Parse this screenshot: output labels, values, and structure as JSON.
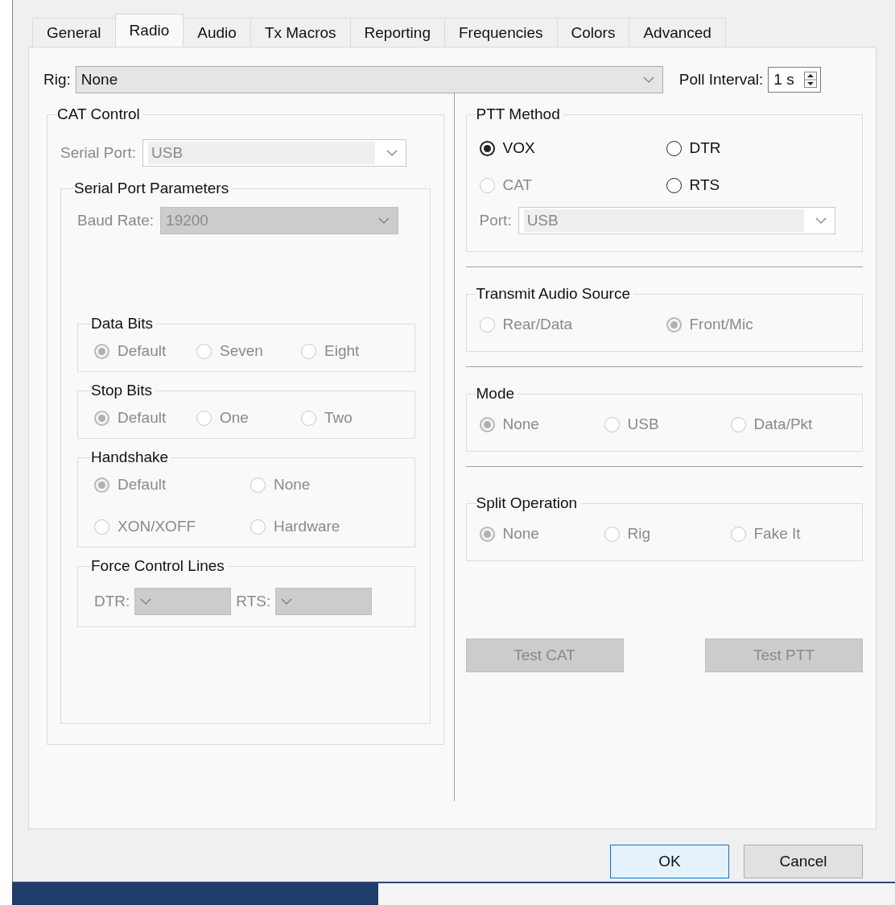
{
  "tabs": [
    {
      "label": "General",
      "selected": false
    },
    {
      "label": "Radio",
      "selected": true
    },
    {
      "label": "Audio",
      "selected": false
    },
    {
      "label": "Tx Macros",
      "selected": false
    },
    {
      "label": "Reporting",
      "selected": false
    },
    {
      "label": "Frequencies",
      "selected": false
    },
    {
      "label": "Colors",
      "selected": false
    },
    {
      "label": "Advanced",
      "selected": false
    }
  ],
  "rig": {
    "label": "Rig:",
    "value": "None",
    "kind": "list",
    "disabled": false
  },
  "poll_interval": {
    "label": "Poll Interval:",
    "value": "1 s"
  },
  "cat_control": {
    "title": "CAT Control",
    "serial_port": {
      "label": "Serial Port:",
      "value": "USB",
      "kind": "combo",
      "disabled": true
    },
    "serial_port_parameters": {
      "title": "Serial Port Parameters",
      "baud_rate": {
        "label": "Baud Rate:",
        "value": "19200",
        "kind": "list",
        "disabled": true
      },
      "data_bits": {
        "title": "Data Bits",
        "options": [
          {
            "label": "Default",
            "selected": true,
            "disabled": true
          },
          {
            "label": "Seven",
            "selected": false,
            "disabled": true
          },
          {
            "label": "Eight",
            "selected": false,
            "disabled": true
          }
        ]
      },
      "stop_bits": {
        "title": "Stop Bits",
        "options": [
          {
            "label": "Default",
            "selected": true,
            "disabled": true
          },
          {
            "label": "One",
            "selected": false,
            "disabled": true
          },
          {
            "label": "Two",
            "selected": false,
            "disabled": true
          }
        ]
      },
      "handshake": {
        "title": "Handshake",
        "options": [
          {
            "label": "Default",
            "selected": true,
            "disabled": true
          },
          {
            "label": "None",
            "selected": false,
            "disabled": true
          },
          {
            "label": "XON/XOFF",
            "selected": false,
            "disabled": true
          },
          {
            "label": "Hardware",
            "selected": false,
            "disabled": true
          }
        ]
      },
      "force_control_lines": {
        "title": "Force Control Lines",
        "dtr": {
          "label": "DTR:",
          "kind": "list",
          "disabled": true
        },
        "rts": {
          "label": "RTS:",
          "kind": "list",
          "disabled": true
        }
      }
    }
  },
  "ptt_method": {
    "title": "PTT Method",
    "options": [
      {
        "label": "VOX",
        "selected": true,
        "disabled": false
      },
      {
        "label": "DTR",
        "selected": false,
        "disabled": false
      },
      {
        "label": "CAT",
        "selected": false,
        "disabled": true
      },
      {
        "label": "RTS",
        "selected": false,
        "disabled": false
      }
    ],
    "port": {
      "label": "Port:",
      "value": "USB",
      "kind": "combo",
      "disabled": true
    }
  },
  "transmit_audio_source": {
    "title": "Transmit Audio Source",
    "options": [
      {
        "label": "Rear/Data",
        "selected": false,
        "disabled": true
      },
      {
        "label": "Front/Mic",
        "selected": true,
        "disabled": true
      }
    ]
  },
  "mode": {
    "title": "Mode",
    "options": [
      {
        "label": "None",
        "selected": true,
        "disabled": true
      },
      {
        "label": "USB",
        "selected": false,
        "disabled": true
      },
      {
        "label": "Data/Pkt",
        "selected": false,
        "disabled": true
      }
    ]
  },
  "split_operation": {
    "title": "Split Operation",
    "options": [
      {
        "label": "None",
        "selected": true,
        "disabled": true
      },
      {
        "label": "Rig",
        "selected": false,
        "disabled": true
      },
      {
        "label": "Fake It",
        "selected": false,
        "disabled": true
      }
    ]
  },
  "test_buttons": [
    {
      "label": "Test CAT",
      "disabled": true
    },
    {
      "label": "Test PTT",
      "disabled": true
    }
  ],
  "dialog_buttons": [
    {
      "label": "OK",
      "default": true
    },
    {
      "label": "Cancel",
      "default": false
    }
  ]
}
